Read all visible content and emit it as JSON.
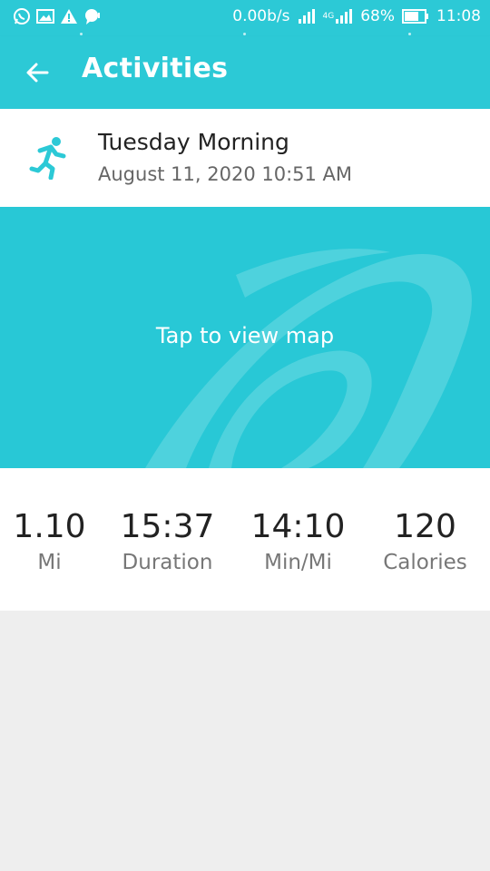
{
  "status_bar": {
    "network_speed": "0.00b/s",
    "network_type": "4G",
    "battery": "68%",
    "time": "11:08",
    "left_icons": [
      "whatsapp-icon",
      "gallery-icon",
      "warning-icon",
      "chat-icon"
    ]
  },
  "app_bar": {
    "back_icon": "arrow-left-icon",
    "title": "Activities"
  },
  "activity": {
    "icon": "running-person-icon",
    "name": "Tuesday Morning",
    "datetime": "August 11, 2020 10:51 AM"
  },
  "map": {
    "label": "Tap to view map"
  },
  "stats": [
    {
      "value": "1.10",
      "label": "Mi"
    },
    {
      "value": "15:37",
      "label": "Duration"
    },
    {
      "value": "14:10",
      "label": "Min/Mi"
    },
    {
      "value": "120",
      "label": "Calories"
    }
  ],
  "colors": {
    "accent": "#2cc9d6",
    "map_bg": "#28c8d6",
    "content_bg": "#eeeeee"
  }
}
